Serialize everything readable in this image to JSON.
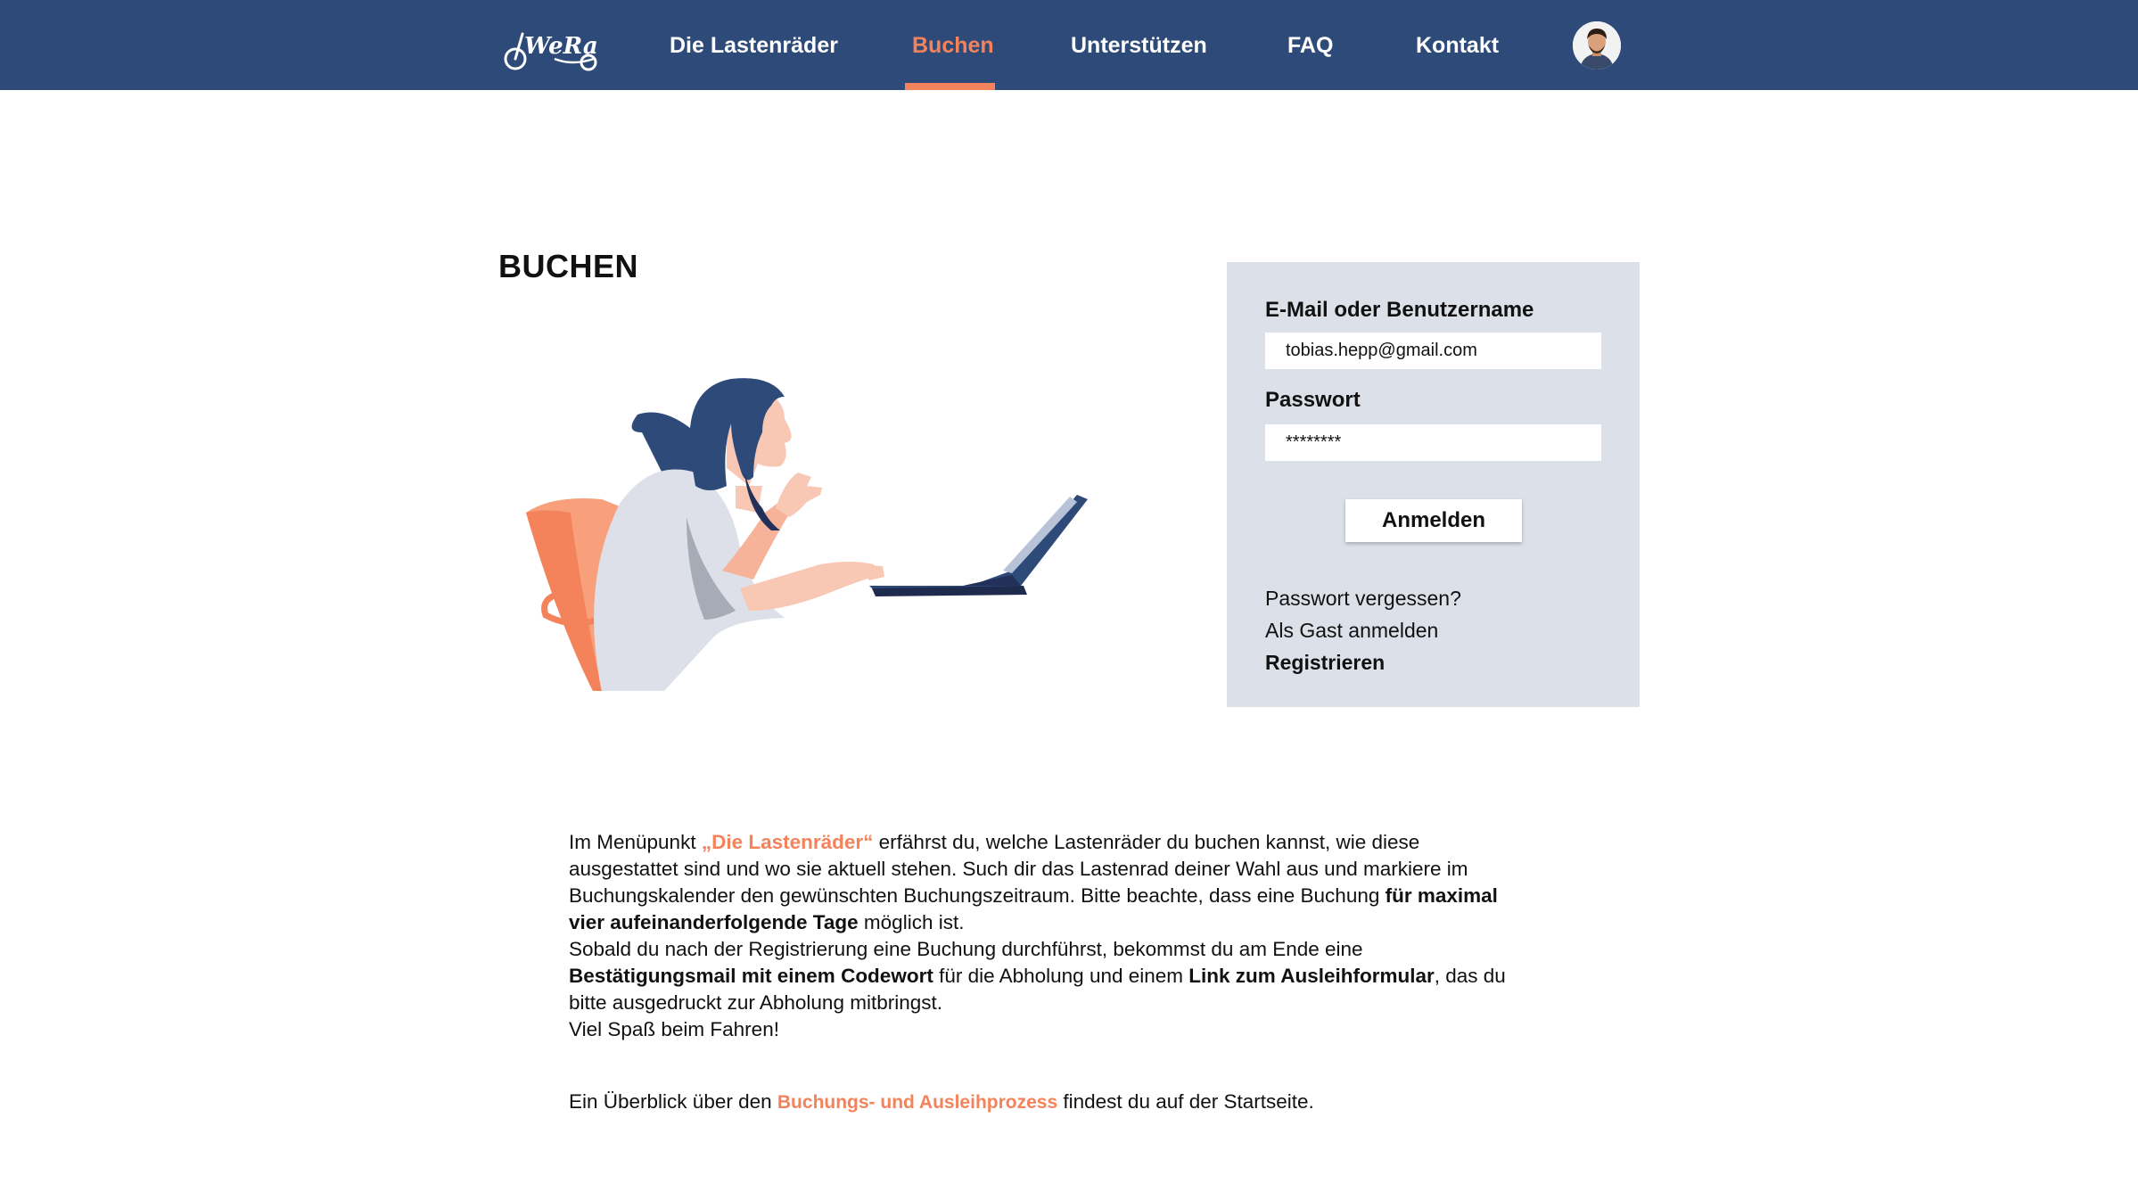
{
  "nav": {
    "logo_text": "WeRa",
    "items": [
      {
        "label": "Die Lastenräder"
      },
      {
        "label": "Buchen",
        "active": true
      },
      {
        "label": "Unterstützen"
      },
      {
        "label": "FAQ"
      },
      {
        "label": "Kontakt"
      }
    ]
  },
  "colors": {
    "nav_bg": "#2d4a79",
    "accent": "#f4825a",
    "panel_bg": "#dce0e8"
  },
  "main": {
    "title": "BUCHEN"
  },
  "login": {
    "email_label": "E-Mail oder Benutzername",
    "email_value": "tobias.hepp@gmail.com",
    "password_label": "Passwort",
    "password_value": "********",
    "submit_label": "Anmelden",
    "forgot_label": "Passwort vergessen?",
    "guest_label": "Als Gast anmelden",
    "register_label": "Registrieren"
  },
  "info": {
    "p1_a": "Im Menüpunkt ",
    "p1_link": "„Die Lastenräder“",
    "p1_b": " erfährst du, welche Lastenräder du buchen kannst, wie diese ausgestattet sind und wo sie aktuell stehen. Such dir das Lastenrad deiner Wahl aus und markiere im Buchungskalender den gewünschten Buchungszeitraum. Bitte beachte, dass eine Buchung ",
    "p1_bold": "für maximal vier aufeinanderfolgende Tage",
    "p1_c": " möglich ist.",
    "p2_a": "Sobald du nach der Registrierung eine Buchung durchführst, bekommst du am Ende eine ",
    "p2_bold1": "Bestätigungsmail mit einem Codewort",
    "p2_b": " für die Abholung und einem ",
    "p2_bold2": "Link zum Ausleihformular",
    "p2_c": ", das du bitte ausgedruckt zur Abholung mitbringst.",
    "p3": "Viel Spaß beim Fahren!",
    "overview_a": "Ein Überblick über den ",
    "overview_link": "Buchungs- und Ausleihprozess",
    "overview_b": " findest du auf der Startseite."
  }
}
